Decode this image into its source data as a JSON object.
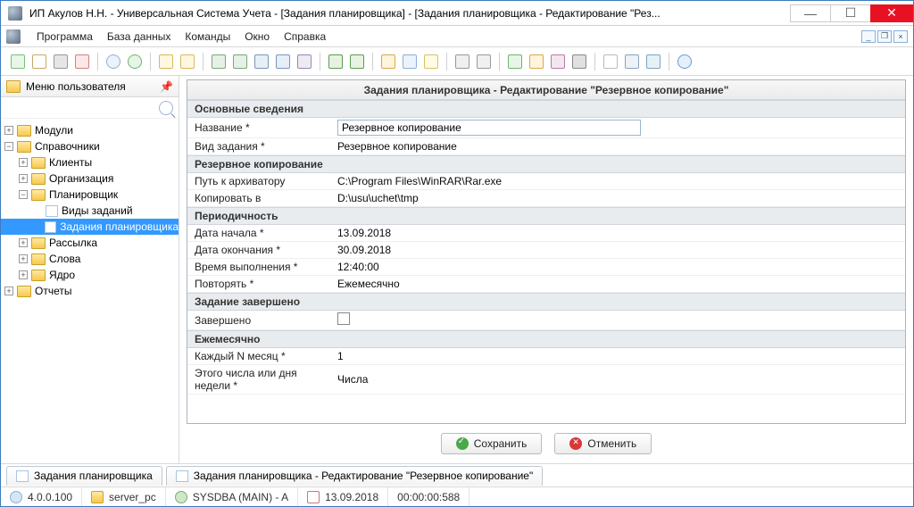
{
  "window": {
    "title": "ИП Акулов Н.Н. - Универсальная Система Учета - [Задания планировщика] - [Задания планировщика - Редактирование \"Рез..."
  },
  "menu": {
    "program": "Программа",
    "database": "База данных",
    "commands": "Команды",
    "window": "Окно",
    "help": "Справка"
  },
  "sidebar": {
    "title": "Меню пользователя",
    "tree": {
      "modules": "Модули",
      "refs": "Справочники",
      "clients": "Клиенты",
      "org": "Организация",
      "planner": "Планировщик",
      "task_types": "Виды заданий",
      "planner_tasks": "Задания планировщика",
      "mailing": "Рассылка",
      "words": "Слова",
      "core": "Ядро",
      "reports": "Отчеты"
    }
  },
  "panel": {
    "title": "Задания планировщика - Редактирование \"Резервное копирование\"",
    "sections": {
      "main": "Основные сведения",
      "backup": "Резервное копирование",
      "period": "Периодичность",
      "done": "Задание завершено",
      "monthly": "Ежемесячно"
    },
    "labels": {
      "name": "Название *",
      "type": "Вид задания *",
      "archpath": "Путь к архиватору",
      "copyto": "Копировать в",
      "start": "Дата начала *",
      "end": "Дата окончания *",
      "exectime": "Время выполнения *",
      "repeat": "Повторять *",
      "completed": "Завершено",
      "each_n_month": "Каждый N месяц *",
      "this_day": "Этого числа или дня недели *"
    },
    "values": {
      "name": "Резервное копирование",
      "type": "Резервное копирование",
      "archpath": "C:\\Program Files\\WinRAR\\Rar.exe",
      "copyto": "D:\\usu\\uchet\\tmp",
      "start": "13.09.2018",
      "end": "30.09.2018",
      "exectime": "12:40:00",
      "repeat": "Ежемесячно",
      "each_n_month": "1",
      "this_day": "Числа"
    },
    "buttons": {
      "save": "Сохранить",
      "cancel": "Отменить"
    }
  },
  "tabs": {
    "tab1": "Задания планировщика",
    "tab2": "Задания планировщика - Редактирование \"Резервное копирование\""
  },
  "status": {
    "version": "4.0.0.100",
    "server": "server_pc",
    "user": "SYSDBA (MAIN) - A",
    "date": "13.09.2018",
    "elapsed": "00:00:00:588"
  }
}
